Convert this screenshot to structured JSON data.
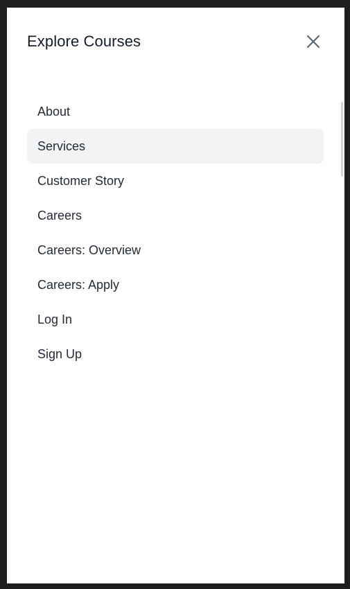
{
  "panel": {
    "title": "Explore Courses",
    "close_icon": "close-icon"
  },
  "menu": {
    "items": [
      {
        "label": "About",
        "active": false
      },
      {
        "label": "Services",
        "active": true
      },
      {
        "label": "Customer Story",
        "active": false
      },
      {
        "label": "Careers",
        "active": false
      },
      {
        "label": "Careers: Overview",
        "active": false
      },
      {
        "label": "Careers: Apply",
        "active": false
      },
      {
        "label": "Log In",
        "active": false
      },
      {
        "label": "Sign Up",
        "active": false
      }
    ]
  },
  "colors": {
    "page_background": "#1e1e1f",
    "panel_background": "#ffffff",
    "active_item_background": "#f2f3f5",
    "text": "#232a38",
    "close_icon": "#5a6478"
  }
}
